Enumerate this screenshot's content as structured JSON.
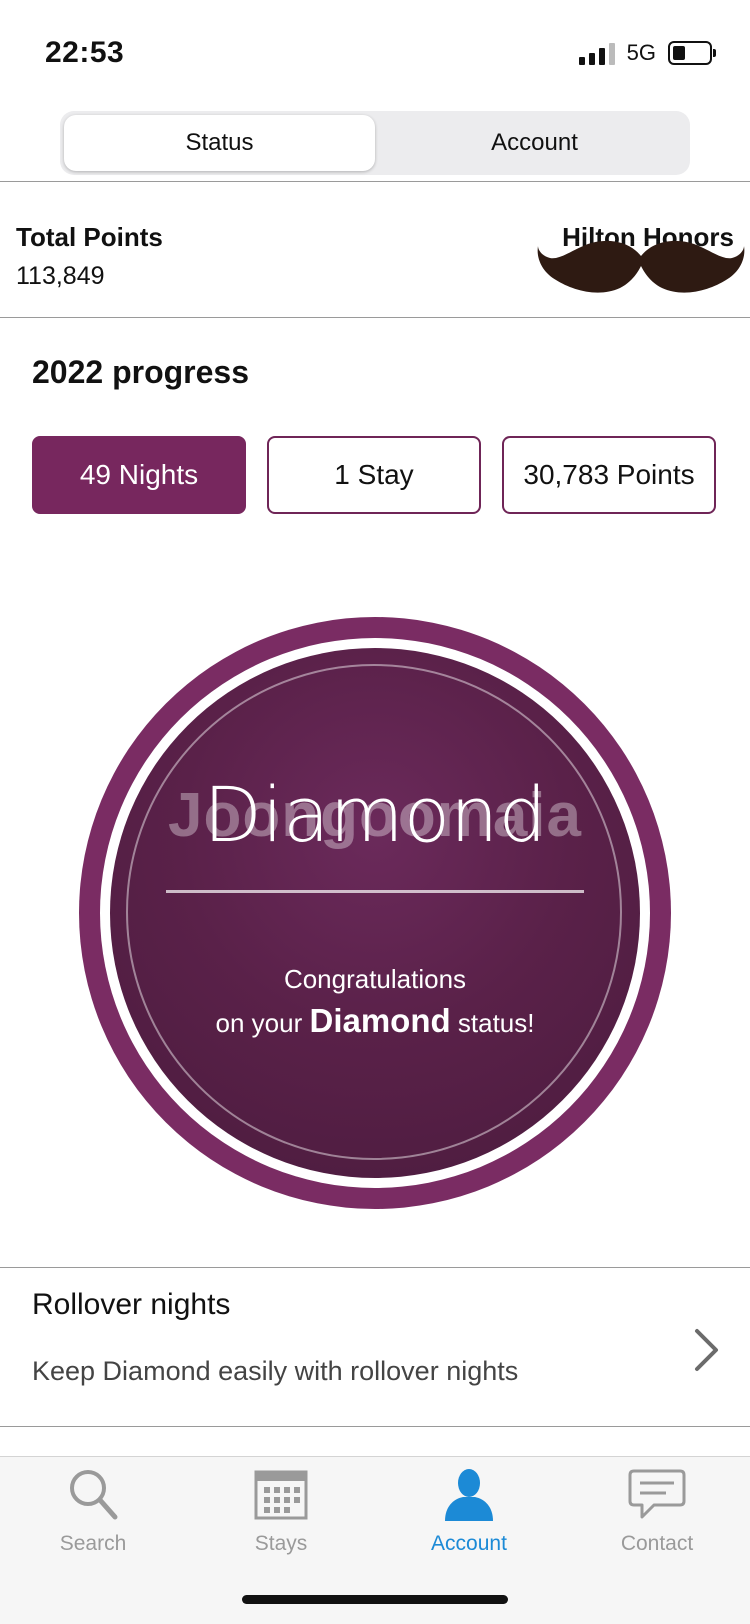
{
  "status_bar": {
    "time": "22:53",
    "network": "5G"
  },
  "segment": {
    "tabs": [
      "Status",
      "Account"
    ],
    "active": "Status"
  },
  "points": {
    "title": "Total Points",
    "value": "113,849",
    "program": "Hilton Honors"
  },
  "progress": {
    "title": "2022 progress",
    "pills": [
      {
        "label": "49 Nights",
        "active": true
      },
      {
        "label": "1 Stay",
        "active": false
      },
      {
        "label": "30,783 Points",
        "active": false
      }
    ]
  },
  "status_circle": {
    "tier": "Diamond",
    "watermark": "Joongoomaia",
    "congrats_line1": "Congratulations",
    "congrats_prefix": "on your",
    "congrats_tier": "Diamond",
    "congrats_suffix": "status!"
  },
  "rollover": {
    "title": "Rollover nights",
    "subtitle": "Keep Diamond easily with rollover nights"
  },
  "tabbar": {
    "items": [
      {
        "label": "Search",
        "icon": "search-icon"
      },
      {
        "label": "Stays",
        "icon": "calendar-icon"
      },
      {
        "label": "Account",
        "icon": "person-icon",
        "active": true
      },
      {
        "label": "Contact",
        "icon": "chat-bubble-icon"
      }
    ]
  },
  "colors": {
    "brand_plum": "#77275e",
    "tab_active": "#1c8ad6",
    "tab_inactive": "#9a9a9a"
  }
}
